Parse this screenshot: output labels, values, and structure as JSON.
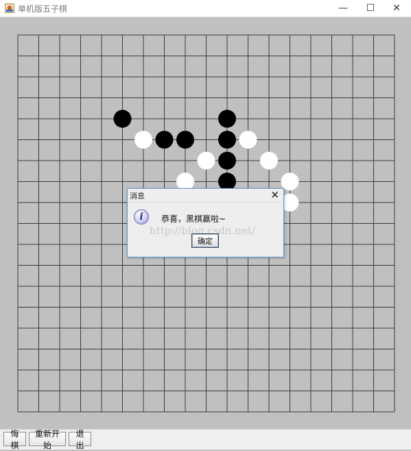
{
  "window": {
    "title": "单机版五子棋",
    "minimize_glyph": "—",
    "maximize_glyph": "☐",
    "close_glyph": "✕",
    "icon": "java-cup-icon"
  },
  "board": {
    "grid_lines": 19,
    "background_color": "#c0c0c0",
    "line_color": "#3a3a3a",
    "black_color": "#000000",
    "white_color": "#ffffff",
    "stones": [
      {
        "color": "black",
        "col": 5,
        "row": 4
      },
      {
        "color": "white",
        "col": 6,
        "row": 5
      },
      {
        "color": "black",
        "col": 7,
        "row": 5
      },
      {
        "color": "black",
        "col": 8,
        "row": 5
      },
      {
        "color": "black",
        "col": 10,
        "row": 4
      },
      {
        "color": "black",
        "col": 10,
        "row": 5
      },
      {
        "color": "white",
        "col": 11,
        "row": 5
      },
      {
        "color": "white",
        "col": 9,
        "row": 6
      },
      {
        "color": "black",
        "col": 10,
        "row": 6
      },
      {
        "color": "white",
        "col": 12,
        "row": 6
      },
      {
        "color": "white",
        "col": 8,
        "row": 7
      },
      {
        "color": "black",
        "col": 10,
        "row": 7
      },
      {
        "color": "white",
        "col": 13,
        "row": 7
      },
      {
        "color": "white",
        "col": 13,
        "row": 8
      }
    ]
  },
  "dialog": {
    "title": "消息",
    "close_glyph": "✕",
    "icon": "information-icon",
    "message": "恭喜，黑棋赢啦~",
    "ok_label": "确定",
    "watermark": "http://blog.csdn.net/"
  },
  "toolbar": {
    "undo_label": "悔棋",
    "restart_label": "重新开始",
    "quit_label": "退出"
  }
}
